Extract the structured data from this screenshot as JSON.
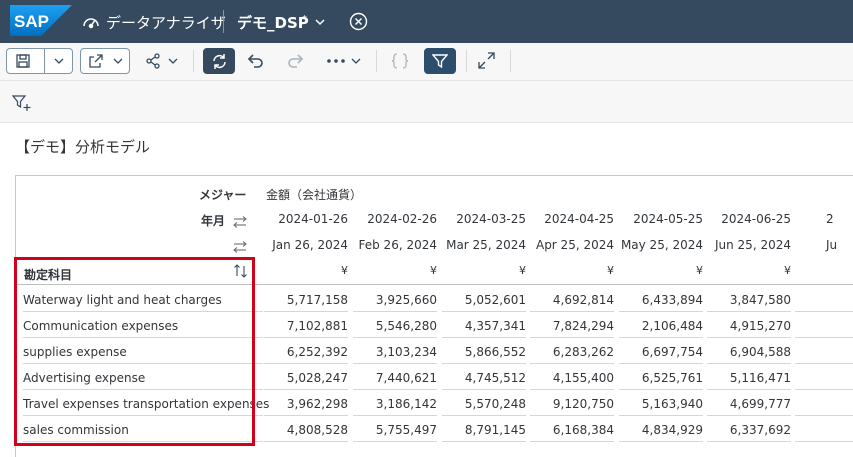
{
  "shell": {
    "logo_text": "SAP",
    "app_title": "データアナライザ",
    "doc_title": "デモ_DSP",
    "doc_modified": "*"
  },
  "toolbar": {
    "items": [
      "save-icon",
      "dropdown-chevron-icon",
      "export-icon",
      "share-icon",
      "refresh-icon",
      "undo-icon",
      "redo-icon",
      "more-icon",
      "code-icon",
      "filter-icon",
      "fullscreen-icon"
    ]
  },
  "page": {
    "title": "【デモ】分析モデル"
  },
  "table": {
    "measure_label": "メジャー",
    "measure_value": "金額（会社通貨）",
    "yearmonth_label": "年月",
    "account_header": "勘定科目",
    "currency_symbol": "¥",
    "columns": [
      {
        "date": "2024-01-26",
        "label": "Jan 26, 2024"
      },
      {
        "date": "2024-02-26",
        "label": "Feb 26, 2024"
      },
      {
        "date": "2024-03-25",
        "label": "Mar 25, 2024"
      },
      {
        "date": "2024-04-25",
        "label": "Apr 25, 2024"
      },
      {
        "date": "2024-05-25",
        "label": "May 25, 2024"
      },
      {
        "date": "2024-06-25",
        "label": "Jun 25, 2024"
      },
      {
        "date": "2",
        "label": "Ju"
      }
    ],
    "rows": [
      {
        "label": "Waterway light and heat charges",
        "values": [
          "5,717,158",
          "3,925,660",
          "5,052,601",
          "4,692,814",
          "6,433,894",
          "3,847,580"
        ]
      },
      {
        "label": "Communication expenses",
        "values": [
          "7,102,881",
          "5,546,280",
          "4,357,341",
          "7,824,294",
          "2,106,484",
          "4,915,270"
        ]
      },
      {
        "label": "supplies expense",
        "values": [
          "6,252,392",
          "3,103,234",
          "5,866,552",
          "6,283,262",
          "6,697,754",
          "6,904,588"
        ]
      },
      {
        "label": "Advertising expense",
        "values": [
          "5,028,247",
          "7,440,621",
          "4,745,512",
          "4,155,400",
          "6,525,761",
          "5,116,471"
        ]
      },
      {
        "label": "Travel expenses transportation expenses",
        "values": [
          "3,962,298",
          "3,186,142",
          "5,570,248",
          "9,120,750",
          "5,163,940",
          "4,699,777"
        ]
      },
      {
        "label": "sales commission",
        "values": [
          "4,808,528",
          "5,755,497",
          "8,791,145",
          "6,168,384",
          "4,834,929",
          "6,337,692"
        ]
      }
    ]
  },
  "colors": {
    "shell": "#354a5f",
    "highlight": "#d0021b",
    "accent": "#0a6ed1"
  }
}
